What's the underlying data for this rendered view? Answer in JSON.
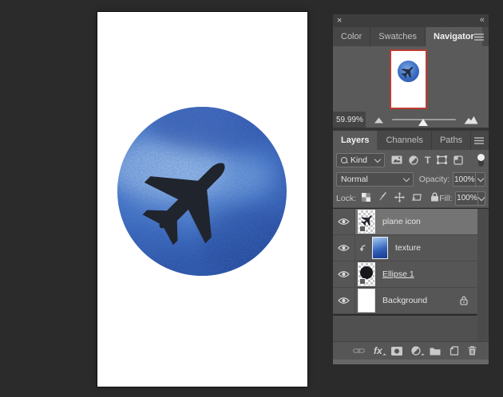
{
  "navigator": {
    "tabs": [
      {
        "label": "Color"
      },
      {
        "label": "Swatches"
      },
      {
        "label": "Navigator"
      }
    ],
    "active_tab": "Navigator",
    "zoom_value": "59.99%",
    "close_glyph": "×",
    "collapse_glyph": "«"
  },
  "layers": {
    "tabs": [
      {
        "label": "Layers"
      },
      {
        "label": "Channels"
      },
      {
        "label": "Paths"
      }
    ],
    "active_tab": "Layers",
    "filter_kind_label": "Kind",
    "type_filter_glyph": "T",
    "blend_mode_value": "Normal",
    "opacity_label": "Opacity:",
    "opacity_value": "100%",
    "lock_label": "Lock:",
    "fill_label": "Fill:",
    "fill_value": "100%",
    "rows": [
      {
        "name": "plane icon",
        "selected": true,
        "type": "shape"
      },
      {
        "name": "texture",
        "clipped": true,
        "type": "image"
      },
      {
        "name": "Ellipse 1",
        "selected": false,
        "type": "shape"
      },
      {
        "name": "Background",
        "locked": true,
        "type": "background"
      }
    ],
    "toolbar_fx_label": "fx"
  },
  "colors": {
    "app_background": "#2b2b2b",
    "panel_body": "#5a5a5a",
    "selection_highlight": "#747474",
    "navigator_preview_border": "#bf3b33",
    "artwork_blue_light": "#a9c9f0",
    "artwork_blue_mid": "#3b6cc2",
    "artwork_blue_dark": "#1e4094",
    "plane_silhouette": "#20242c"
  }
}
